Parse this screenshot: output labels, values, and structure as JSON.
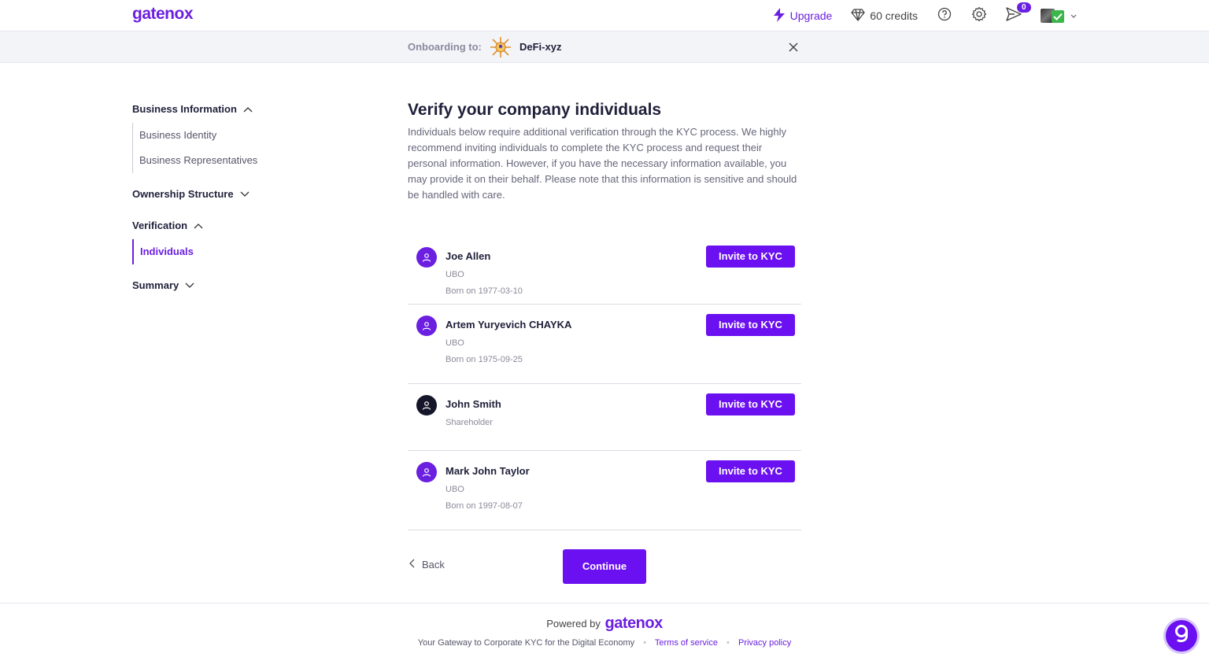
{
  "header": {
    "logo": "gatenox",
    "upgrade_label": "Upgrade",
    "credits_label": "60 credits",
    "notifications_count": "0"
  },
  "onboarding": {
    "label": "Onboarding to:",
    "company_name": "DeFi-xyz"
  },
  "sidebar": {
    "sections": [
      {
        "title": "Business Information",
        "expanded": true,
        "items": [
          "Business Identity",
          "Business Representatives"
        ]
      },
      {
        "title": "Ownership Structure",
        "expanded": false,
        "items": []
      },
      {
        "title": "Verification",
        "expanded": true,
        "items": [
          "Individuals"
        ],
        "active_item": "Individuals"
      },
      {
        "title": "Summary",
        "expanded": false,
        "items": []
      }
    ]
  },
  "main": {
    "title": "Verify your company individuals",
    "description": "Individuals below require additional verification through the KYC process. We highly recommend inviting individuals to complete the KYC process and request their personal information. However, if you have the necessary information available, you may provide it on their behalf. Please note that this information is sensitive and should be handled with care.",
    "individuals": [
      {
        "name": "Joe Allen",
        "role": "UBO",
        "born": "Born on 1977-03-10",
        "button": "Invite to KYC"
      },
      {
        "name": "Artem Yuryevich CHAYKA",
        "role": "UBO",
        "born": "Born on 1975-09-25",
        "button": "Invite to KYC"
      },
      {
        "name": "John Smith",
        "role": "Shareholder",
        "born": "",
        "button": "Invite to KYC"
      },
      {
        "name": "Mark John Taylor",
        "role": "UBO",
        "born": "Born on 1997-08-07",
        "button": "Invite to KYC"
      }
    ],
    "back_label": "Back",
    "continue_label": "Continue"
  },
  "footer": {
    "powered_by": "Powered by",
    "logo": "gatenox",
    "tagline": "Your Gateway to Corporate KYC for the Digital Economy",
    "terms_label": "Terms of service",
    "privacy_label": "Privacy policy"
  },
  "colors": {
    "brand": "#6b10f0",
    "text_dark": "#1f1f3a",
    "text_muted": "#66667a"
  },
  "icons": [
    "lightning-icon",
    "diamond-icon",
    "help-icon",
    "gear-icon",
    "send-icon",
    "chevron-down-icon",
    "close-icon",
    "user-icon",
    "chevron-left-icon",
    "chevron-up-icon"
  ]
}
